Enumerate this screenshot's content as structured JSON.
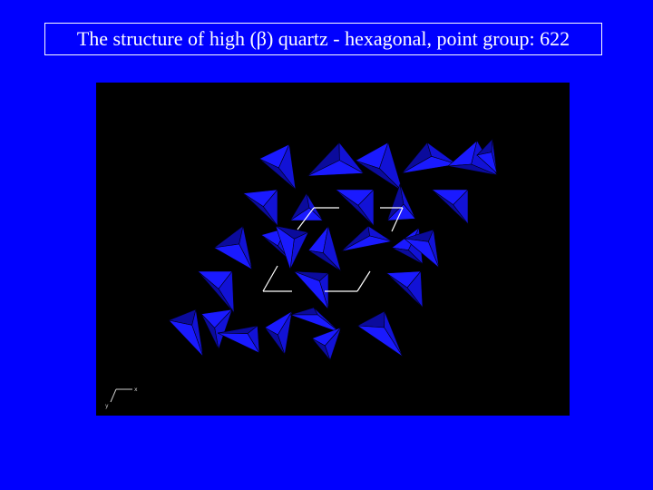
{
  "slide": {
    "title": "The structure of high (β) quartz -  hexagonal, point group: 622"
  },
  "viewer": {
    "background": "#000000",
    "polyhedra": {
      "kind": "SiO4 tetrahedra",
      "light_color": "#1a1aff",
      "dark_color": "#0b0b9c",
      "mid_color": "#1212d6"
    },
    "unit_cell": {
      "color": "#ffffff"
    },
    "axes": {
      "x_label": "x",
      "y_label": "y"
    }
  }
}
